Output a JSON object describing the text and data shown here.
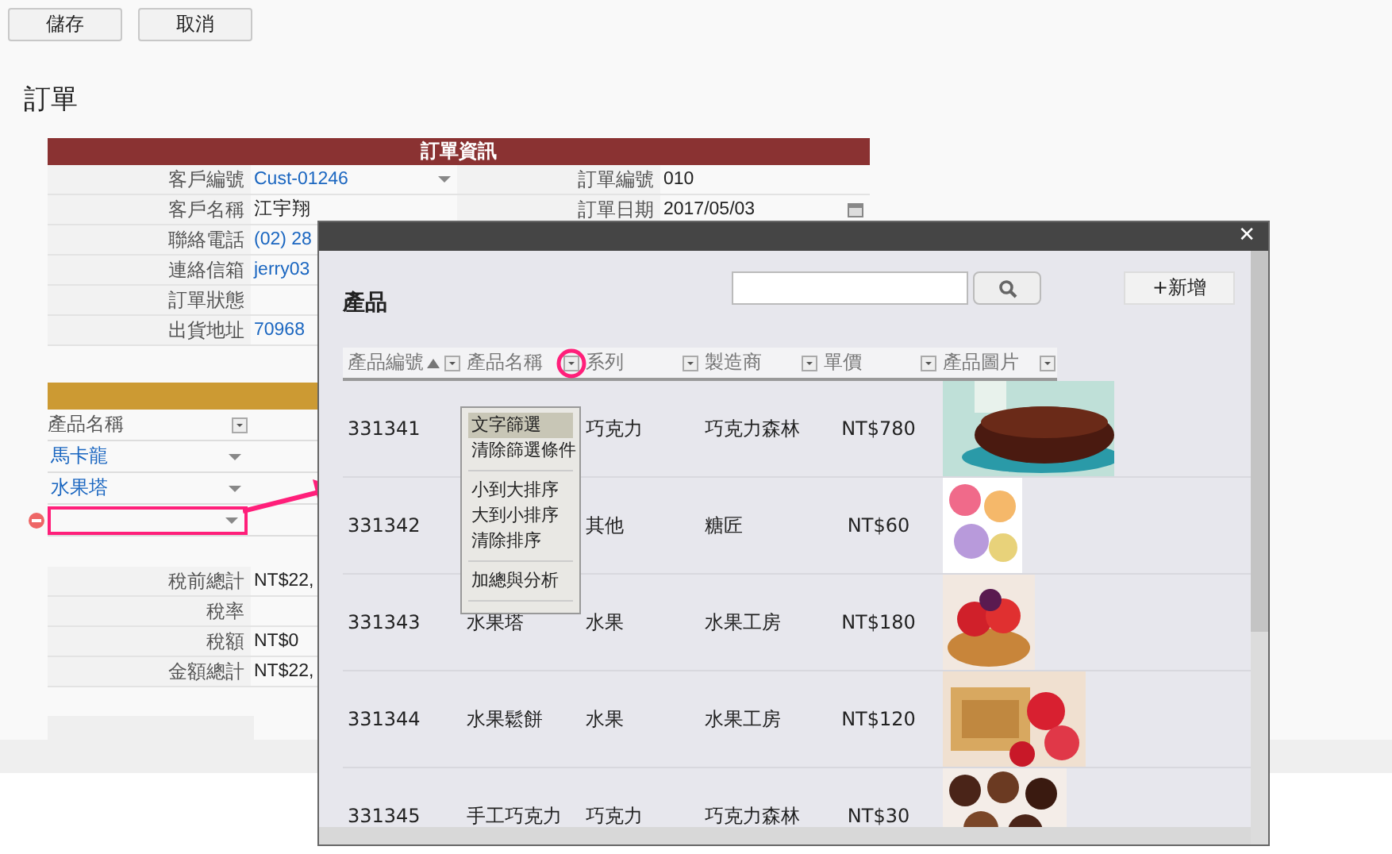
{
  "toolbar": {
    "buttons": [
      "儲存",
      "取消"
    ]
  },
  "page_title": "訂單",
  "order_info": {
    "title": "訂單資訊",
    "rows": [
      {
        "left": {
          "label": "客戶編號",
          "value": "Cust-01246",
          "kind": "link-select"
        },
        "right": {
          "label": "訂單編號",
          "value": "010",
          "kind": "text"
        }
      },
      {
        "left": {
          "label": "客戶名稱",
          "value": "江宇翔",
          "kind": "text"
        },
        "right": {
          "label": "訂單日期",
          "value": "2017/05/03",
          "kind": "date"
        }
      },
      {
        "left": {
          "label": "聯絡電話",
          "value": "(02) 28",
          "kind": "link"
        }
      },
      {
        "left": {
          "label": "連絡信箱",
          "value": "jerry03",
          "kind": "link"
        }
      },
      {
        "left": {
          "label": "訂單狀態",
          "kind": "text"
        }
      },
      {
        "left": {
          "label": "出貨地址",
          "value": "70968",
          "kind": "link"
        }
      }
    ]
  },
  "items": {
    "header": "產品名稱",
    "rows": [
      {
        "value": "馬卡龍",
        "selected": false
      },
      {
        "value": "水果塔",
        "selected": false
      },
      {
        "selected": true
      }
    ]
  },
  "totals": [
    {
      "label": "稅前總計",
      "value": "NT$22,"
    },
    {
      "label": "稅率"
    },
    {
      "label": "稅額",
      "value": "NT$0"
    },
    {
      "label": "金額總計",
      "value": "NT$22,"
    }
  ],
  "modal": {
    "close": "✕",
    "title": "產品",
    "add_button": "+新增",
    "columns": [
      {
        "label": "產品編號",
        "sorted_ascending": true,
        "highlighted": false
      },
      {
        "label": "產品名稱",
        "sorted_ascending": false,
        "highlighted": true
      },
      {
        "label": "系列",
        "sorted_ascending": false,
        "highlighted": false
      },
      {
        "label": "製造商",
        "sorted_ascending": false,
        "highlighted": false
      },
      {
        "label": "單價",
        "sorted_ascending": false,
        "highlighted": false
      },
      {
        "label": "產品圖片",
        "sorted_ascending": false,
        "highlighted": false
      }
    ],
    "rows": [
      {
        "id": "331341",
        "series": "巧克力",
        "maker": "巧克力森林",
        "price": "NT$780"
      },
      {
        "id": "331342",
        "series": "其他",
        "maker": "糖匠",
        "price": "NT$60"
      },
      {
        "id": "331343",
        "name": "水果塔",
        "series": "水果",
        "maker": "水果工房",
        "price": "NT$180"
      },
      {
        "id": "331344",
        "name": "水果鬆餅",
        "series": "水果",
        "maker": "水果工房",
        "price": "NT$120"
      },
      {
        "id": "331345",
        "name": "手工巧克力",
        "series": "巧克力",
        "maker": "巧克力森林",
        "price": "NT$30"
      }
    ],
    "menu": {
      "groups": [
        [
          {
            "label": "文字篩選",
            "selected": true
          },
          {
            "label": "清除篩選條件",
            "selected": false
          }
        ],
        [
          {
            "label": "小到大排序",
            "selected": false
          },
          {
            "label": "大到小排序",
            "selected": false
          },
          {
            "label": "清除排序",
            "selected": false
          }
        ],
        [
          {
            "label": "加總與分析",
            "selected": false
          }
        ]
      ]
    }
  }
}
